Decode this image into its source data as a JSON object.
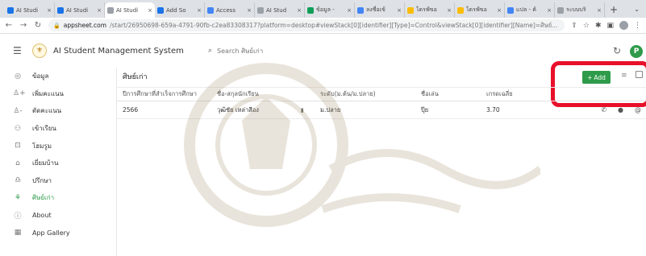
{
  "browser": {
    "tabs": [
      {
        "title": "AI Studi",
        "icon": "appsheet-icon",
        "color": "#1a73e8",
        "active": false
      },
      {
        "title": "AI Studi",
        "icon": "appsheet-icon",
        "color": "#1a73e8",
        "active": false
      },
      {
        "title": "AI Studi",
        "icon": "appsheet-icon",
        "color": "#9aa0a6",
        "active": true
      },
      {
        "title": "Add So",
        "icon": "appsheet-icon",
        "color": "#1a73e8",
        "active": false
      },
      {
        "title": "Access",
        "icon": "google-icon",
        "color": "#4285f4",
        "active": false
      },
      {
        "title": "AI Stud",
        "icon": "appsheet-icon",
        "color": "#9aa0a6",
        "active": false
      },
      {
        "title": "ข้อมูล -",
        "icon": "sheets-icon",
        "color": "#0f9d58",
        "active": false
      },
      {
        "title": "ลงชื่อเข้",
        "icon": "google-icon",
        "color": "#4285f4",
        "active": false
      },
      {
        "title": "ไดรฟ์ขอ",
        "icon": "drive-icon",
        "color": "#fbbc04",
        "active": false
      },
      {
        "title": "ไดรฟ์ขอ",
        "icon": "drive-icon",
        "color": "#fbbc04",
        "active": false
      },
      {
        "title": "แปล - ค้",
        "icon": "google-icon",
        "color": "#4285f4",
        "active": false
      },
      {
        "title": "ระบบบริ",
        "icon": "appsheet-icon",
        "color": "#9aa0a6",
        "active": false
      }
    ],
    "new_tab": "+",
    "tab_menu": "⌄",
    "url_host": "appsheet.com",
    "url_path": "/start/26950698-659a-4791-90fb-c2ea83308317?platform=desktop#viewStack[0][identifier][Type]=Control&viewStack[0][identifier][Name]=ศิษย์..."
  },
  "app": {
    "title": "AI Student Management System",
    "search_placeholder": "Search ศิษย์เก่า",
    "profile_initial": "P",
    "accent_color": "#2e9b4a"
  },
  "sidebar": {
    "items": [
      {
        "label": "ข้อมูล",
        "icon": "account-circle-icon",
        "active": false
      },
      {
        "label": "เพิ่มคะแนน",
        "icon": "person-add-icon",
        "active": false
      },
      {
        "label": "ตัดคะแนน",
        "icon": "person-remove-icon",
        "active": false
      },
      {
        "label": "เข้าเรียน",
        "icon": "people-icon",
        "active": false
      },
      {
        "label": "โฮมรูม",
        "icon": "classroom-icon",
        "active": false
      },
      {
        "label": "เยี่ยมบ้าน",
        "icon": "family-icon",
        "active": false
      },
      {
        "label": "ปรึกษา",
        "icon": "counsel-icon",
        "active": false
      },
      {
        "label": "ศิษย์เก่า",
        "icon": "alumni-icon",
        "active": true
      },
      {
        "label": "About",
        "icon": "info-icon",
        "active": false
      },
      {
        "label": "App Gallery",
        "icon": "grid-icon",
        "active": false
      }
    ]
  },
  "view": {
    "title": "ศิษย์เก่า",
    "add_label": "Add",
    "columns": [
      "ปีการศึกษาที่สำเร็จการศึกษา",
      "ชื่อ-สกุลนักเรียน",
      "ระดับ(ม.ต้น/ม.ปลาย)",
      "ชื่อเล่น",
      "เกรดเฉลี่ย"
    ],
    "rows": [
      {
        "year": "2566",
        "name": "วุฒิชัย เหล่าสีอง",
        "level": "ม.ปลาย",
        "nickname": "ปุ๊ย",
        "gpa": "3.70"
      }
    ]
  }
}
